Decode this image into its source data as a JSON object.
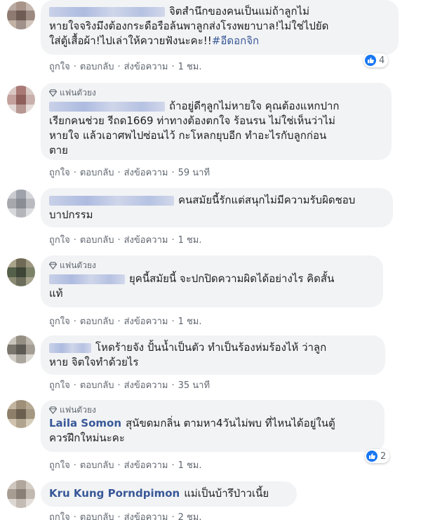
{
  "labels": {
    "like": "ถูกใจ",
    "reply": "ตอบกลับ",
    "message": "ส่งข้อความ",
    "top_fan": "แฟนตัวยง",
    "separator": "·"
  },
  "comments": [
    {
      "lines": [
        "จิตสำนึกของคนเป็นแม่ถ้าลูกไม่",
        "หายใจจริงมึงต้องกระดือรือล้นพาลูกส่งโรงพยาบาล!ไม่ใช่ไปยัด",
        "ใส่ตู้เสื้อผ้า!ไปเล่าให้ควายฟังนะคะ!!"
      ],
      "hashtag": "#อีดอกจิก",
      "time": "1 ชม.",
      "reaction_count": "4"
    },
    {
      "top_fan": true,
      "lines": [
        "ถ้าอยู่ดีๆลูกไม่หายใจ คุณต้องแหกปาก",
        "เรียกคนช่วย รีถด1669 ท่าทางต้องตกใจ ร้อนรน ไม่ใช่เห็นว่าไม่",
        "หายใจ แล้วเอาศพไปซ่อนไว้ กะโหลกยุบอีก ทำอะไรกับลูกก่อน",
        "ตาย"
      ],
      "time": "59 นาที"
    },
    {
      "lines": [
        "คนสมัยนี้รักแต่สนุกไม่มีความรับผิดชอบ",
        "บาปกรรม"
      ],
      "time": "1 ชม."
    },
    {
      "top_fan": true,
      "lines": [
        "ยุคนี้สมัยนี้ จะปกปิดความผิดได้อย่างไร คิดสั้น",
        "แท้"
      ],
      "time": "1 ชม."
    },
    {
      "lines": [
        "โหดร้ายจัง ปั้นน้ำเป็นตัว ทำเป็นร้องห่มร้องไห้ ว่าลูก",
        "หาย จิตใจทำด้วยไร"
      ],
      "time": "35 นาที"
    },
    {
      "top_fan": true,
      "author": "Laila Somon",
      "lines": [
        "สุนัขดมกลิ่น ตามหา4วันไม่พบ ที่ไหนได้อยู่ในตู้",
        "ควรฝึกใหม่นะคะ"
      ],
      "time": "1 ชม.",
      "reaction_count": "2"
    },
    {
      "author": "Kru Kung Porndpimon",
      "lines": [
        "แม่เป็นบ้ารึป่าวเนี้ย"
      ],
      "time": "2 ชม."
    }
  ],
  "colors": {
    "bubble": "#f2f3f5",
    "link": "#385898",
    "meta": "#606770",
    "like_blue": "#1877f2"
  },
  "icons": [
    "like-reaction-icon",
    "top-fan-diamond-icon"
  ]
}
